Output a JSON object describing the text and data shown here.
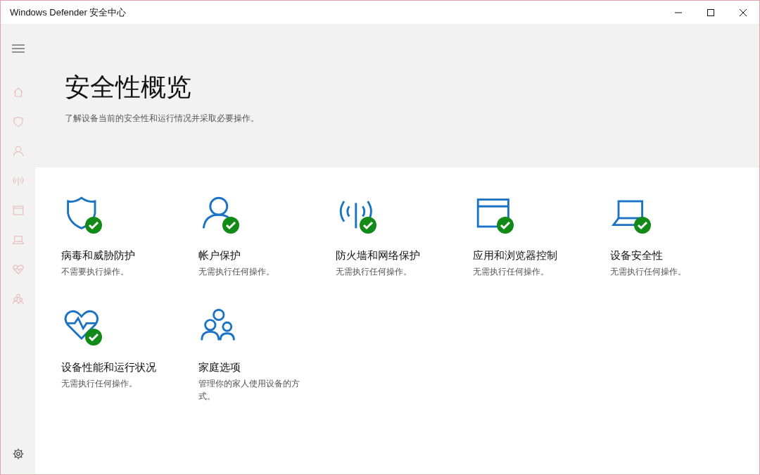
{
  "window": {
    "title": "Windows Defender 安全中心"
  },
  "sidebar": {
    "items": [
      {
        "kind": "home"
      },
      {
        "kind": "shield"
      },
      {
        "kind": "person"
      },
      {
        "kind": "antenna"
      },
      {
        "kind": "browser"
      },
      {
        "kind": "laptop"
      },
      {
        "kind": "heart"
      },
      {
        "kind": "family"
      }
    ]
  },
  "header": {
    "title": "安全性概览",
    "subtitle": "了解设备当前的安全性和运行情况并采取必要操作。"
  },
  "tiles": [
    {
      "kind": "shield",
      "title": "病毒和威胁防护",
      "status": "不需要执行操作。",
      "checked": true
    },
    {
      "kind": "person",
      "title": "帐户保护",
      "status": "无需执行任何操作。",
      "checked": true
    },
    {
      "kind": "antenna",
      "title": "防火墙和网络保护",
      "status": "无需执行任何操作。",
      "checked": true
    },
    {
      "kind": "browser",
      "title": "应用和浏览器控制",
      "status": "无需执行任何操作。",
      "checked": true
    },
    {
      "kind": "laptop",
      "title": "设备安全性",
      "status": "无需执行任何操作。",
      "checked": true
    },
    {
      "kind": "heart",
      "title": "设备性能和运行状况",
      "status": "无需执行任何操作。",
      "checked": true
    },
    {
      "kind": "family",
      "title": "家庭选项",
      "status": "管理你的家人使用设备的方式。",
      "checked": false
    }
  ]
}
